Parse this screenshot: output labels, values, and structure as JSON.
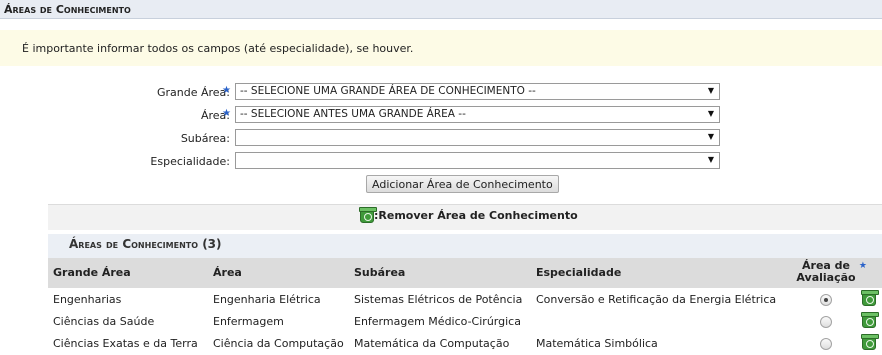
{
  "section": {
    "title": "Áreas de Conhecimento"
  },
  "notice": {
    "text": "É importante informar todos os campos (até especialidade), se houver."
  },
  "form": {
    "grande_area": {
      "label": "Grande Área:",
      "value": "-- SELECIONE UMA GRANDE ÁREA DE CONHECIMENTO --",
      "required": true
    },
    "area": {
      "label": "Área:",
      "value": "-- SELECIONE ANTES UMA GRANDE ÁREA --",
      "required": true
    },
    "subarea": {
      "label": "Subárea:",
      "value": ""
    },
    "especialidade": {
      "label": "Especialidade:",
      "value": ""
    },
    "add_button": "Adicionar Área de Conhecimento",
    "required_marker": "★",
    "dropdown_arrow": "▼"
  },
  "legend": {
    "remove_label": ":Remover Área de Conhecimento",
    "icon": "trash-icon"
  },
  "table": {
    "title": "Áreas de Conhecimento (3)",
    "headers": {
      "grande_area": "Grande Área",
      "area": "Área",
      "subarea": "Subárea",
      "especialidade": "Especialidade",
      "avaliacao_line1": "Área de",
      "avaliacao_line2": "Avaliação"
    },
    "rows": [
      {
        "grande_area": "Engenharias",
        "area": "Engenharia Elétrica",
        "subarea": "Sistemas Elétricos de Potência",
        "especialidade": "Conversão e Retificação da Energia Elétrica",
        "avaliacao": true
      },
      {
        "grande_area": "Ciências da Saúde",
        "area": "Enfermagem",
        "subarea": "Enfermagem Médico-Cirúrgica",
        "especialidade": "",
        "avaliacao": false
      },
      {
        "grande_area": "Ciências Exatas e da Terra",
        "area": "Ciência da Computação",
        "subarea": "Matemática da Computação",
        "especialidade": "Matemática Simbólica",
        "avaliacao": false
      }
    ]
  },
  "colors": {
    "accent_star": "#2a62c9",
    "trash_green": "#3f9a3a",
    "header_bg": "#e8ecf3",
    "notice_bg": "#fdfbe6"
  }
}
